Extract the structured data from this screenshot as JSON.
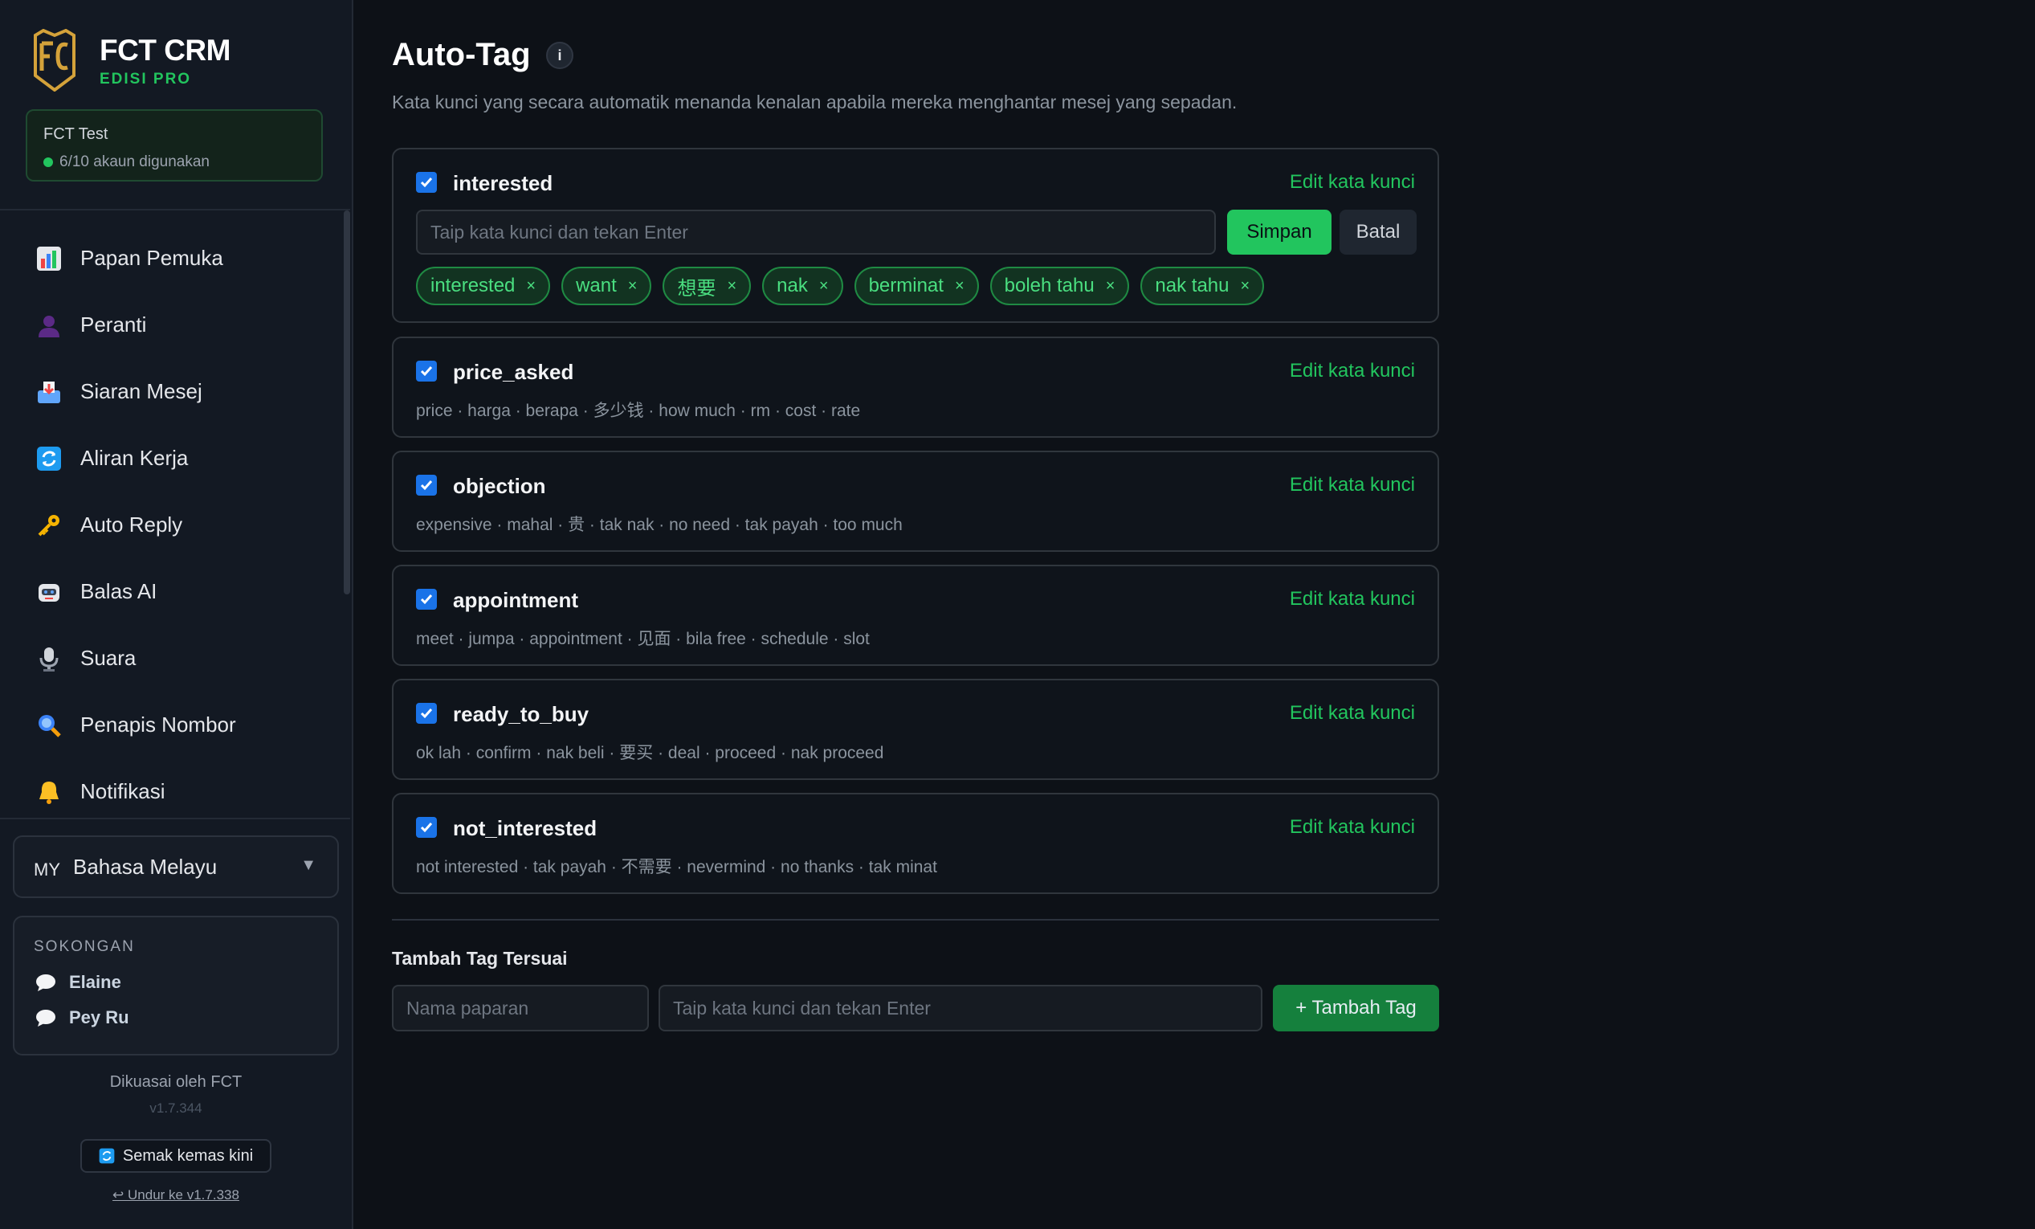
{
  "brand": {
    "name": "FCT CRM",
    "edition": "EDISI PRO"
  },
  "account": {
    "name": "FCT Test",
    "usage": "6/10 akaun digunakan"
  },
  "nav": [
    {
      "label": "Papan Pemuka",
      "icon": "bar-chart-icon"
    },
    {
      "label": "Peranti",
      "icon": "user-silhouette-icon"
    },
    {
      "label": "Siaran Mesej",
      "icon": "inbox-tray-icon"
    },
    {
      "label": "Aliran Kerja",
      "icon": "refresh-arrows-icon"
    },
    {
      "label": "Auto Reply",
      "icon": "key-icon"
    },
    {
      "label": "Balas AI",
      "icon": "robot-icon"
    },
    {
      "label": "Suara",
      "icon": "microphone-icon"
    },
    {
      "label": "Penapis Nombor",
      "icon": "magnifier-icon"
    },
    {
      "label": "Notifikasi",
      "icon": "bell-icon"
    }
  ],
  "language": {
    "code": "MY",
    "name": "Bahasa Melayu"
  },
  "support": {
    "title": "SOKONGAN",
    "contacts": [
      "Elaine",
      "Pey Ru"
    ]
  },
  "footer": {
    "powered": "Dikuasai oleh FCT",
    "version": "v1.7.344",
    "update_label": "Semak kemas kini",
    "rollback_label": "↩ Undur ke v1.7.338"
  },
  "page": {
    "title": "Auto-Tag",
    "info_icon": "i",
    "subtitle": "Kata kunci yang secara automatik menanda kenalan apabila mereka menghantar mesej yang sepadan."
  },
  "edit_label": "Edit kata kunci",
  "editing": {
    "placeholder": "Taip kata kunci dan tekan Enter",
    "save_label": "Simpan",
    "cancel_label": "Batal"
  },
  "tags": [
    {
      "name": "interested",
      "checked": true,
      "editing": true,
      "chips": [
        "interested",
        "want",
        "想要",
        "nak",
        "berminat",
        "boleh tahu",
        "nak tahu"
      ]
    },
    {
      "name": "price_asked",
      "checked": true,
      "keywords": "price · harga · berapa · 多少钱 · how much · rm · cost · rate"
    },
    {
      "name": "objection",
      "checked": true,
      "keywords": "expensive · mahal · 贵 · tak nak · no need · tak payah · too much"
    },
    {
      "name": "appointment",
      "checked": true,
      "keywords": "meet · jumpa · appointment · 见面 · bila free · schedule · slot"
    },
    {
      "name": "ready_to_buy",
      "checked": true,
      "keywords": "ok lah · confirm · nak beli · 要买 · deal · proceed · nak proceed"
    },
    {
      "name": "not_interested",
      "checked": true,
      "keywords": "not interested · tak payah · 不需要 · nevermind · no thanks · tak minat"
    }
  ],
  "custom": {
    "title": "Tambah Tag Tersuai",
    "name_placeholder": "Nama paparan",
    "keywords_placeholder": "Taip kata kunci dan tekan Enter",
    "add_label": "+ Tambah Tag"
  },
  "colors": {
    "accent": "#22c55e",
    "checkbox": "#1a73e8",
    "background": "#0d1117"
  }
}
